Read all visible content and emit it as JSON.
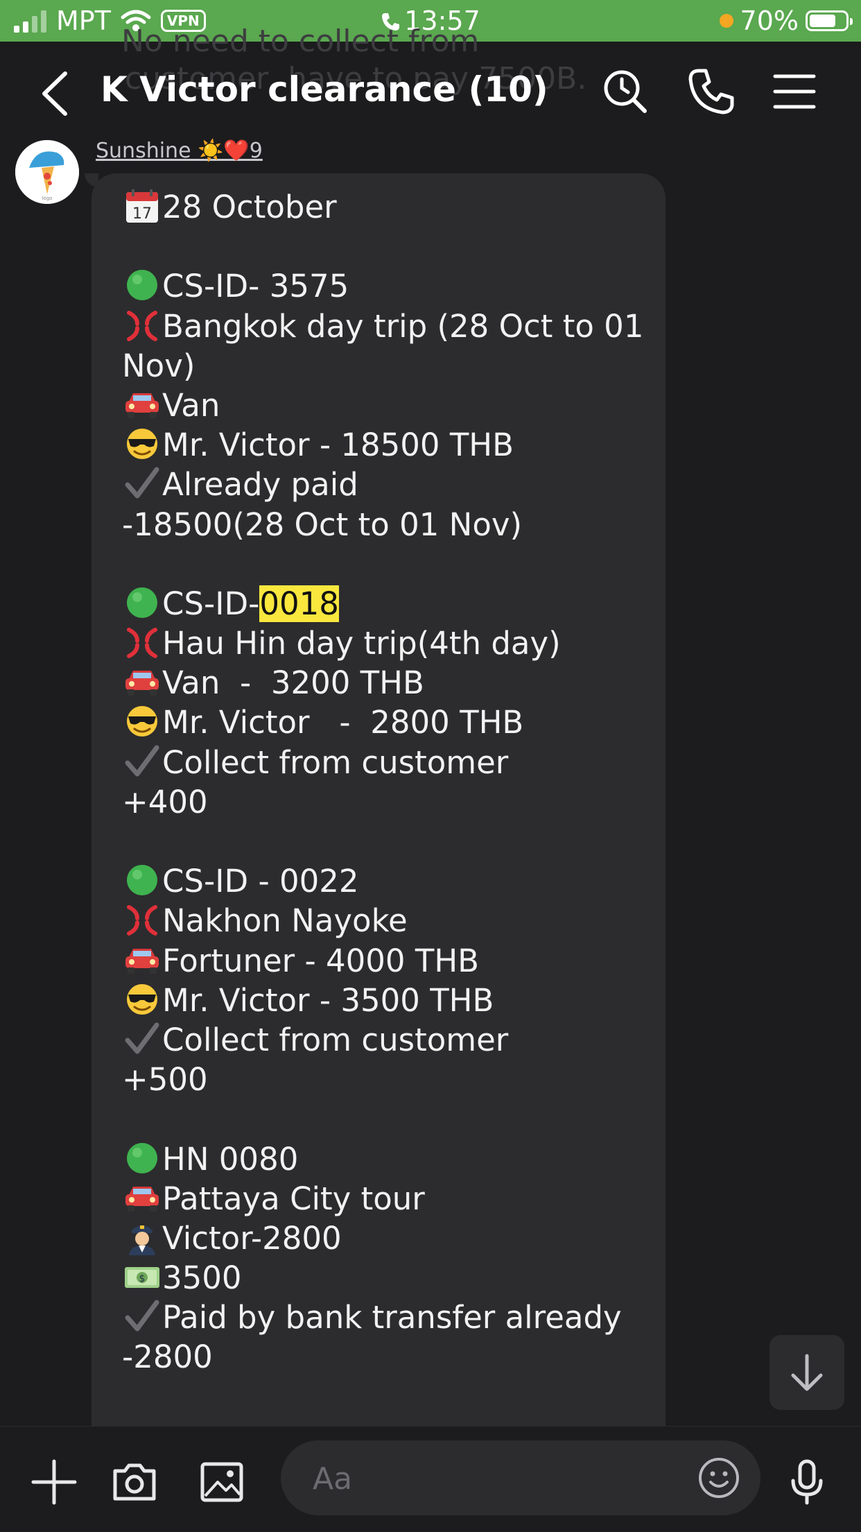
{
  "status_bar": {
    "carrier": "MPT",
    "vpn_label": "VPN",
    "time": "13:57",
    "battery_percent": "70%",
    "battery_level": 0.7
  },
  "header": {
    "title": "K Victor clearance  (10)",
    "background_text_1": "No need to collect from",
    "background_text_2": "customer, have to pay 7500B."
  },
  "message": {
    "sender": "Sunshine ☀️❤️9",
    "date_line": "28 October",
    "entries": [
      {
        "id": "CS-ID- 3575",
        "trip": "Bangkok day trip (28 Oct to 01 Nov)",
        "vehicle": "Van",
        "driver": "Mr. Victor - 18500 THB",
        "status": "Already paid",
        "amount": "-18500(28 Oct to 01 Nov)"
      },
      {
        "id_prefix": "CS-ID-",
        "id_highlight": "0018",
        "trip": "Hau Hin day trip(4th day)",
        "vehicle": "Van  -  3200 THB",
        "driver": "Mr. Victor   -  2800 THB",
        "status": "Collect from customer",
        "amount": "+400"
      },
      {
        "id": "CS-ID - 0022",
        "trip": "Nakhon Nayoke",
        "vehicle": "Fortuner - 4000 THB",
        "driver": "Mr. Victor - 3500 THB",
        "status": "Collect from customer",
        "amount": "+500"
      },
      {
        "id": "HN 0080",
        "trip": "Pattaya City tour",
        "driver": "Victor-2800",
        "cash": "3500",
        "status": "Paid by bank transfer already",
        "amount": "-2800"
      }
    ]
  },
  "composer": {
    "placeholder": "Aa"
  },
  "colors": {
    "status_bar": "#5aa84f",
    "background": "#1c1c1e",
    "bubble": "#2c2c2e",
    "highlight": "#f9e73e"
  }
}
